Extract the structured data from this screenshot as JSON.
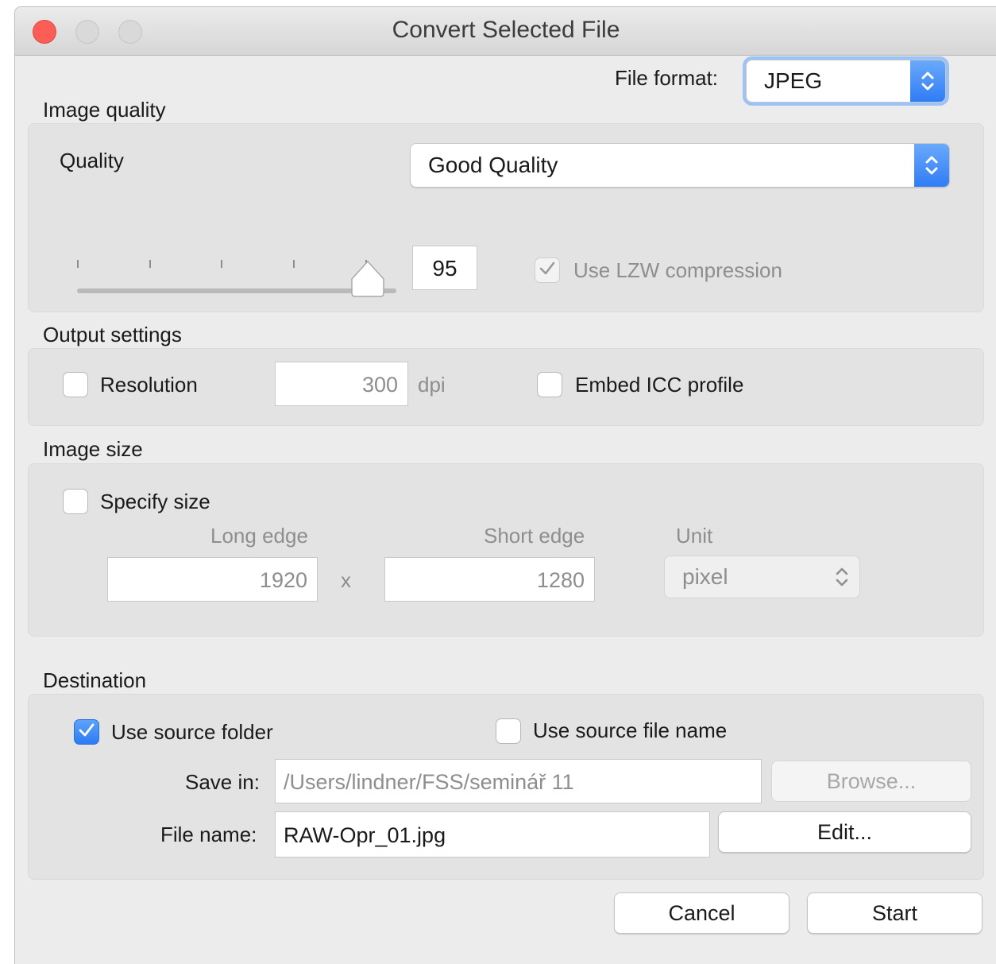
{
  "window": {
    "title": "Convert Selected File"
  },
  "file_format": {
    "label": "File format:",
    "value": "JPEG"
  },
  "image_quality": {
    "section_title": "Image quality",
    "quality_label": "Quality",
    "quality_preset": "Good Quality",
    "slider_value_fraction": 0.91,
    "quality_value": "95",
    "lzw_label": "Use LZW compression",
    "lzw_checked": true,
    "lzw_enabled": false
  },
  "output_settings": {
    "section_title": "Output settings",
    "resolution_label": "Resolution",
    "resolution_checked": false,
    "resolution_value": "300",
    "resolution_unit": "dpi",
    "icc_label": "Embed ICC profile",
    "icc_checked": false
  },
  "image_size": {
    "section_title": "Image size",
    "specify_label": "Specify size",
    "specify_checked": false,
    "long_edge_label": "Long edge",
    "long_edge_value": "1920",
    "separator": "x",
    "short_edge_label": "Short edge",
    "short_edge_value": "1280",
    "unit_label": "Unit",
    "unit_value": "pixel"
  },
  "destination": {
    "section_title": "Destination",
    "use_source_folder_label": "Use source folder",
    "use_source_folder_checked": true,
    "use_source_name_label": "Use source file name",
    "use_source_name_checked": false,
    "save_in_label": "Save in:",
    "save_in_value": "/Users/lindner/FSS/seminář 11",
    "browse_label": "Browse...",
    "file_name_label": "File name:",
    "file_name_value": "RAW-Opr_01.jpg",
    "edit_label": "Edit..."
  },
  "buttons": {
    "cancel": "Cancel",
    "start": "Start"
  },
  "colors": {
    "accent": "#2f7cf5",
    "close": "#fc5d56"
  },
  "icons": {
    "checkmark": "checkmark-icon",
    "updown": "updown-chevron-icon"
  }
}
